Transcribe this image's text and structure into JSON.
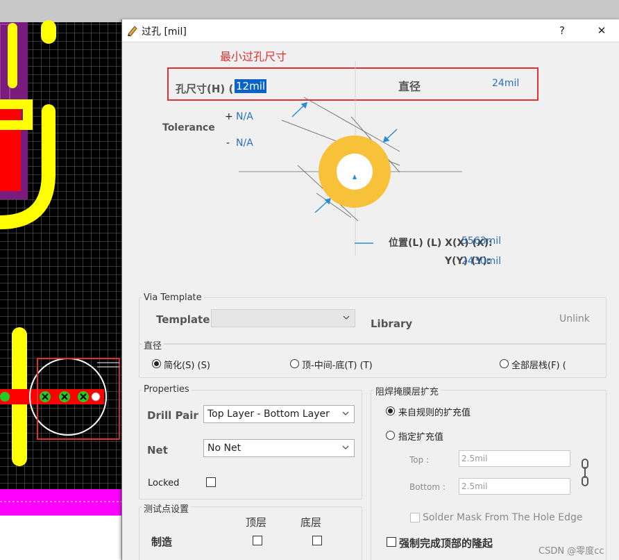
{
  "dialog": {
    "title": "过孔 [mil]",
    "help_label": "?",
    "close_label": "✕"
  },
  "annotation": {
    "label": "最小过孔尺寸",
    "color": "#e03030"
  },
  "diagram": {
    "hole_size_label": "孔尺寸(H) (",
    "hole_size_value": "12mil",
    "diameter_label": "直径",
    "diameter_value": "24mil",
    "tolerance_label": "Tolerance",
    "plus_sign": "+",
    "plus_value": "N/A",
    "minus_sign": "-",
    "minus_value": "N/A",
    "location_label": "位置(L) (L) X(X) (X):",
    "x_value": "5563mil",
    "y_label": "Y(Y) (Y):",
    "y_value": "2430mil",
    "via_color": "#f7c23a"
  },
  "via_template": {
    "group_title": "Via Template",
    "template_label": "Template",
    "template_value": "",
    "library_label": "Library",
    "unlink_label": "Unlink"
  },
  "diameter_mode": {
    "group_title": "直径",
    "options": [
      {
        "label": "简化(S) (S)",
        "selected": true
      },
      {
        "label": "顶-中间-底(T) (T)",
        "selected": false
      },
      {
        "label": "全部层栈(F) (",
        "selected": false
      }
    ]
  },
  "properties": {
    "group_title": "Properties",
    "drill_pair_label": "Drill Pair",
    "drill_pair_value": "Top Layer - Bottom Layer",
    "net_label": "Net",
    "net_value": "No Net",
    "locked_label": "Locked",
    "locked": false
  },
  "solder_mask": {
    "group_title": "阻焊掩膜层扩充",
    "option_rule": "来自规则的扩充值",
    "option_manual": "指定扩充值",
    "top_label": "Top :",
    "top_value": "2.5mil",
    "bottom_label": "Bottom :",
    "bottom_value": "2.5mil",
    "from_hole_label": "Solder Mask From The Hole Edge",
    "force_tenting_label": "强制完成顶部的隆起"
  },
  "testpoint": {
    "group_title": "测试点设置",
    "top_col": "顶层",
    "bottom_col": "底层",
    "row_label": "制造"
  },
  "watermark": "CSDN @零度cc"
}
